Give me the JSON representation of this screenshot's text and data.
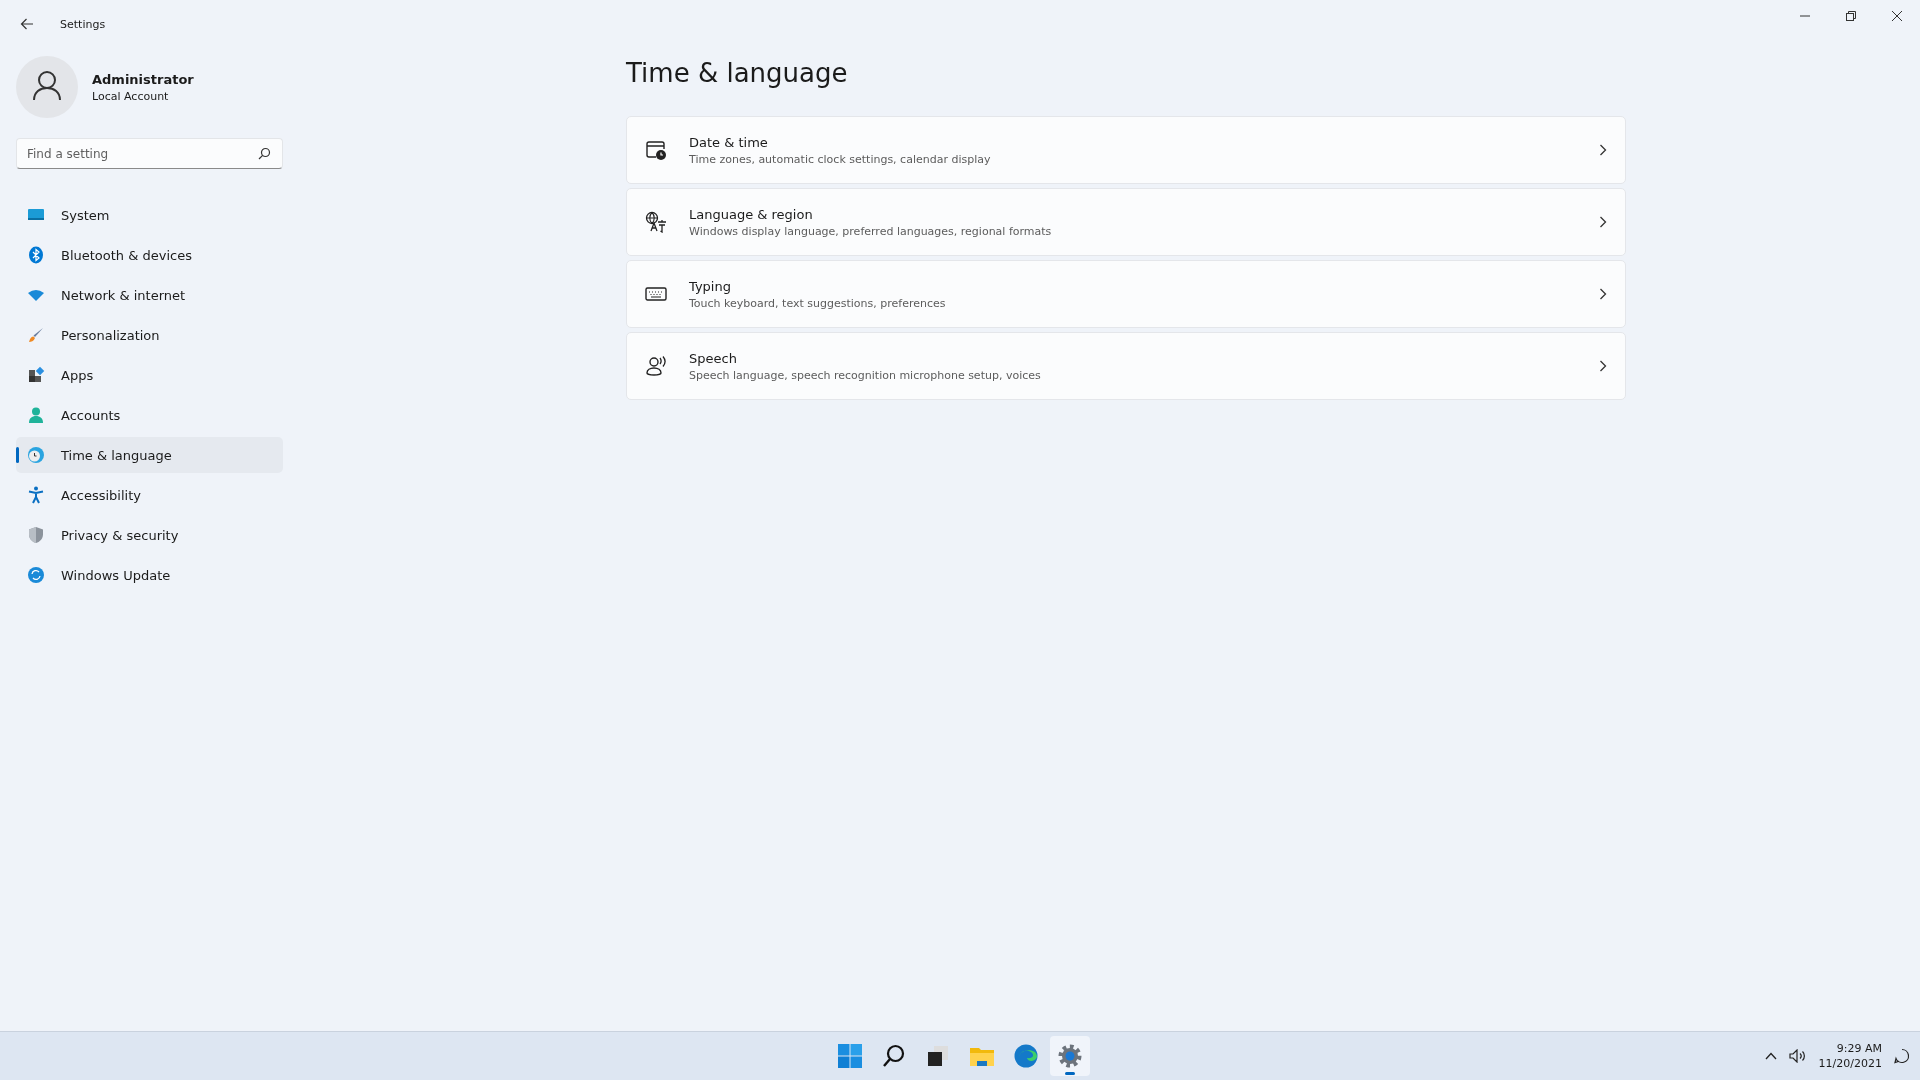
{
  "window": {
    "title": "Settings"
  },
  "account": {
    "name": "Administrator",
    "type": "Local Account"
  },
  "search": {
    "placeholder": "Find a setting"
  },
  "sidebar": {
    "items": [
      {
        "label": "System",
        "kind": "system",
        "selected": false
      },
      {
        "label": "Bluetooth & devices",
        "kind": "bluetooth",
        "selected": false
      },
      {
        "label": "Network & internet",
        "kind": "network",
        "selected": false
      },
      {
        "label": "Personalization",
        "kind": "brush",
        "selected": false
      },
      {
        "label": "Apps",
        "kind": "apps",
        "selected": false
      },
      {
        "label": "Accounts",
        "kind": "accounts",
        "selected": false
      },
      {
        "label": "Time & language",
        "kind": "time",
        "selected": true
      },
      {
        "label": "Accessibility",
        "kind": "accessibility",
        "selected": false
      },
      {
        "label": "Privacy & security",
        "kind": "shield",
        "selected": false
      },
      {
        "label": "Windows Update",
        "kind": "update",
        "selected": false
      }
    ]
  },
  "page": {
    "title": "Time & language",
    "cards": [
      {
        "kind": "calendar",
        "title": "Date & time",
        "description": "Time zones, automatic clock settings, calendar display"
      },
      {
        "kind": "language",
        "title": "Language & region",
        "description": "Windows display language, preferred languages, regional formats"
      },
      {
        "kind": "keyboard",
        "title": "Typing",
        "description": "Touch keyboard, text suggestions, preferences"
      },
      {
        "kind": "speech",
        "title": "Speech",
        "description": "Speech language, speech recognition microphone setup, voices"
      }
    ]
  },
  "taskbar": {
    "apps": [
      {
        "kind": "start",
        "selected": false
      },
      {
        "kind": "search",
        "selected": false
      },
      {
        "kind": "taskview",
        "selected": false
      },
      {
        "kind": "folder",
        "selected": false
      },
      {
        "kind": "browser",
        "selected": false
      },
      {
        "kind": "settings",
        "selected": true
      }
    ],
    "time": "9:29 AM",
    "date": "11/20/2021"
  }
}
